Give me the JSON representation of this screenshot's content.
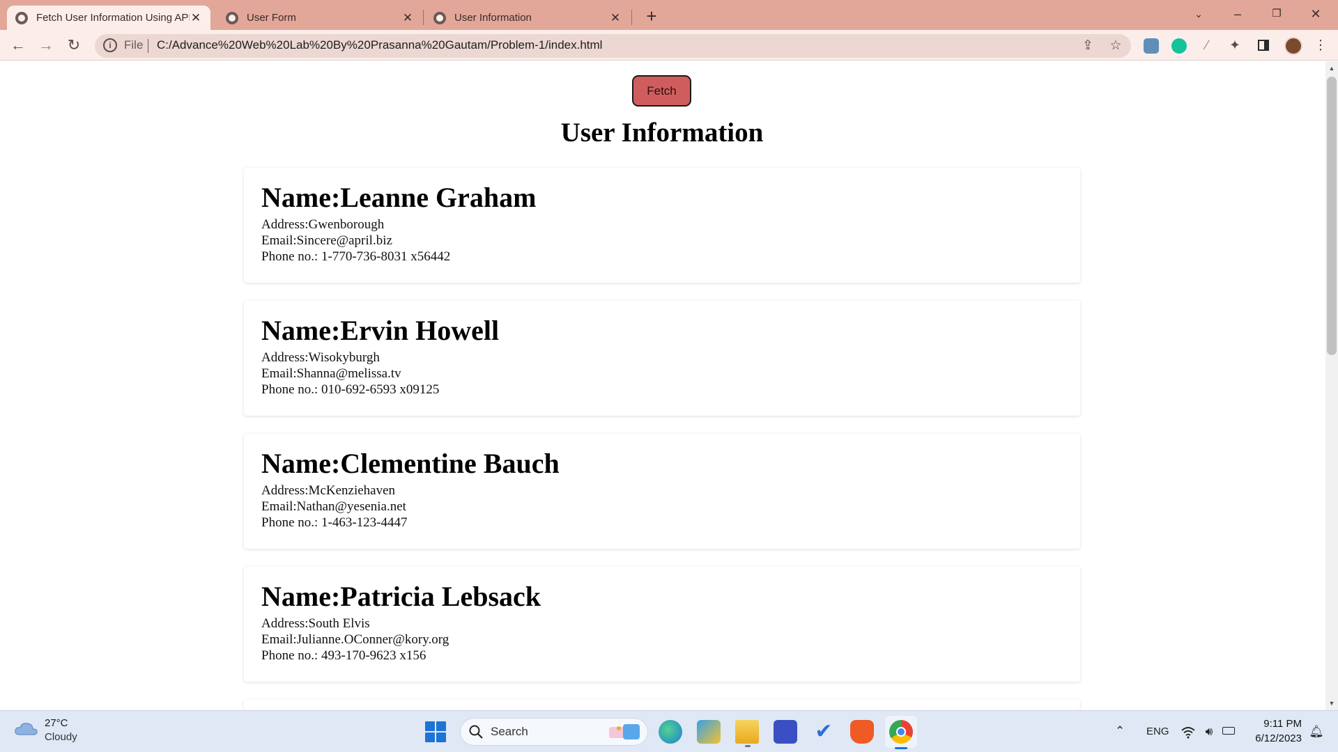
{
  "browser": {
    "tabs": [
      {
        "label": "Fetch User Information Using API",
        "active": true
      },
      {
        "label": "User Form",
        "active": false
      },
      {
        "label": "User Information",
        "active": false
      }
    ],
    "new_tab_label": "+",
    "address": {
      "scheme_label": "File",
      "url": "C:/Advance%20Web%20Lab%20By%20Prasanna%20Gautam/Problem-1/index.html"
    },
    "window_controls": {
      "minimize": "–",
      "restore": "❐",
      "close": "✕"
    }
  },
  "page": {
    "fetch_button_label": "Fetch",
    "title": "User Information",
    "users": [
      {
        "name": "Name:Leanne Graham",
        "address": "Address:Gwenborough",
        "email": "Email:Sincere@april.biz",
        "phone": "Phone no.: 1-770-736-8031 x56442"
      },
      {
        "name": "Name:Ervin Howell",
        "address": "Address:Wisokyburgh",
        "email": "Email:Shanna@melissa.tv",
        "phone": "Phone no.: 010-692-6593 x09125"
      },
      {
        "name": "Name:Clementine Bauch",
        "address": "Address:McKenziehaven",
        "email": "Email:Nathan@yesenia.net",
        "phone": "Phone no.: 1-463-123-4447"
      },
      {
        "name": "Name:Patricia Lebsack",
        "address": "Address:South Elvis",
        "email": "Email:Julianne.OConner@kory.org",
        "phone": "Phone no.: 493-170-9623 x156"
      }
    ]
  },
  "taskbar": {
    "weather": {
      "temp": "27°C",
      "condition": "Cloudy",
      "icon": "cloud-icon"
    },
    "search_label": "Search",
    "apps": [
      "edge-icon",
      "snipping-tool-icon",
      "file-explorer-icon",
      "editor-icon",
      "todo-icon",
      "brave-icon",
      "chrome-icon"
    ],
    "language": "ENG",
    "clock": {
      "time": "9:11 PM",
      "date": "6/12/2023"
    }
  },
  "colors": {
    "titlebar": "#e2a799",
    "toolbar": "#fbeeea",
    "fetch_button": "#d05d5d",
    "taskbar": "#dfe8f4"
  }
}
